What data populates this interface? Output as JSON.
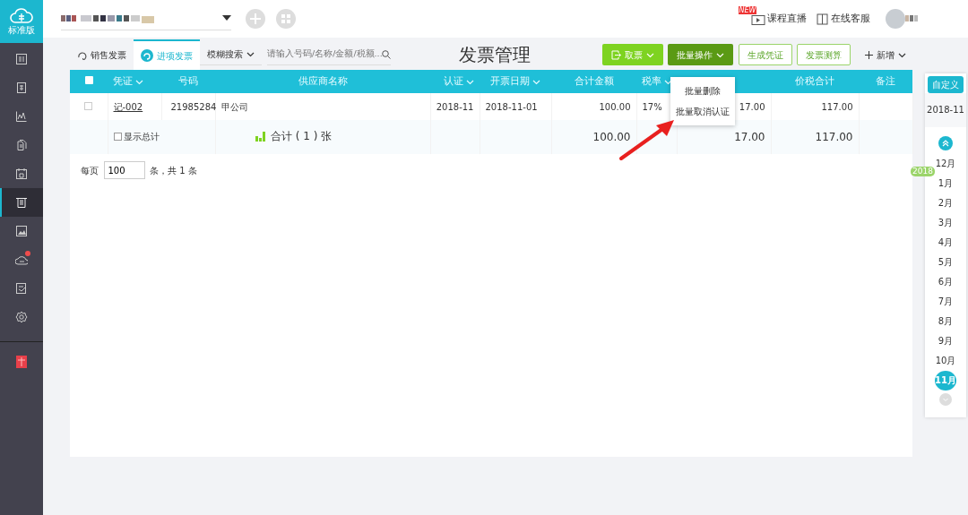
{
  "brand": {
    "label": "标准版"
  },
  "sidebar": {
    "items": [
      {
        "kind": "ledger",
        "selected": false,
        "badge": false
      },
      {
        "kind": "voucher",
        "selected": false,
        "badge": false
      },
      {
        "kind": "chart",
        "selected": false,
        "badge": false
      },
      {
        "kind": "files",
        "selected": false,
        "badge": false
      },
      {
        "kind": "calendar",
        "selected": false,
        "badge": false
      },
      {
        "kind": "invoice",
        "selected": true,
        "badge": false
      },
      {
        "kind": "image",
        "selected": false,
        "badge": false
      },
      {
        "kind": "cloud",
        "selected": false,
        "badge": true
      },
      {
        "kind": "scan",
        "selected": false,
        "badge": false
      },
      {
        "kind": "gear",
        "selected": false,
        "badge": false
      }
    ]
  },
  "header": {
    "links": [
      {
        "label": "课程直播",
        "tag": "NEW"
      },
      {
        "label": "在线客服"
      }
    ]
  },
  "tabs": [
    {
      "label": "销售发票",
      "selected": false
    },
    {
      "label": "进项发票",
      "selected": true
    }
  ],
  "search": {
    "mode": "模糊搜索",
    "placeholder": "请输入号码/名称/金额/税额..."
  },
  "title": "发票管理",
  "toolbar": [
    {
      "label": "取票",
      "kind": "primary"
    },
    {
      "label": "批量操作",
      "kind": "dark"
    },
    {
      "label": "生成凭证",
      "kind": "outline"
    },
    {
      "label": "发票测算",
      "kind": "outline"
    },
    {
      "label": "新增",
      "kind": "plain"
    }
  ],
  "table": {
    "columns": [
      {
        "label": "凭证",
        "sortable": true
      },
      {
        "label": "号码",
        "sortable": false
      },
      {
        "label": "供应商名称",
        "sortable": false
      },
      {
        "label": "认证",
        "sortable": true
      },
      {
        "label": "开票日期",
        "sortable": true
      },
      {
        "label": "合计金额",
        "sortable": false
      },
      {
        "label": "税率",
        "sortable": true
      },
      {},
      {
        "label": "价税合计",
        "sortable": false
      },
      {
        "label": "备注",
        "sortable": false
      }
    ],
    "all_checked": false,
    "rows": [
      {
        "checked": false,
        "cells": [
          "记-002",
          "21985284",
          "甲公司",
          "2018-11",
          "2018-11-01",
          "100.00",
          "17%",
          "17.00",
          "117.00",
          ""
        ]
      }
    ],
    "total": {
      "show_label": "显示总计",
      "show_checked": false,
      "count": "合计 ( 1 ) 张",
      "amount": "100.00",
      "tax": "17.00",
      "sum": "117.00"
    }
  },
  "batch_menu": {
    "items": [
      "批量删除",
      "批量取消认证"
    ]
  },
  "pagination": {
    "prefix": "每页",
    "page_size": "100",
    "summary": "条，共 1 条"
  },
  "month_picker": {
    "custom": "自定义",
    "current": "2018-11",
    "year_tag": "2018",
    "months": [
      {
        "label": "12月",
        "selected": false
      },
      {
        "label": "1月",
        "selected": false
      },
      {
        "label": "2月",
        "selected": false
      },
      {
        "label": "3月",
        "selected": false
      },
      {
        "label": "4月",
        "selected": false
      },
      {
        "label": "5月",
        "selected": false
      },
      {
        "label": "6月",
        "selected": false
      },
      {
        "label": "7月",
        "selected": false
      },
      {
        "label": "8月",
        "selected": false
      },
      {
        "label": "9月",
        "selected": false
      },
      {
        "label": "10月",
        "selected": false
      },
      {
        "label": "11月",
        "selected": true
      }
    ]
  }
}
